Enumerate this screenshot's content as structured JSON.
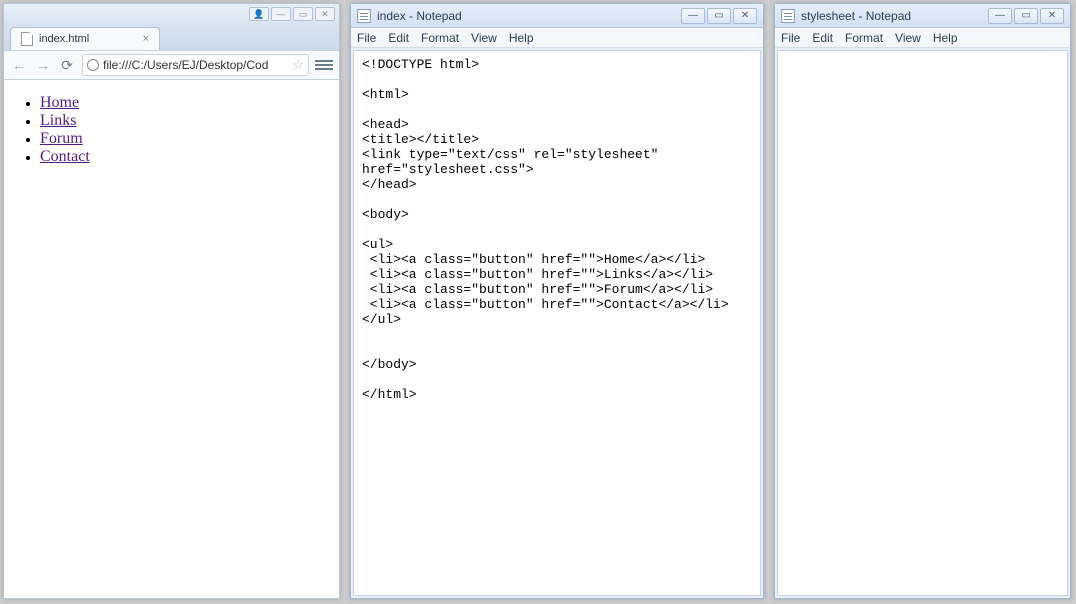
{
  "chrome": {
    "tab_title": "index.html",
    "url": "file:///C:/Users/EJ/Desktop/Cod",
    "links": [
      "Home",
      "Links",
      "Forum",
      "Contact"
    ]
  },
  "notepad1": {
    "title": "index - Notepad",
    "menu": {
      "file": "File",
      "edit": "Edit",
      "format": "Format",
      "view": "View",
      "help": "Help"
    },
    "content": "<!DOCTYPE html>\n\n<html>\n\n<head>\n<title></title>\n<link type=\"text/css\" rel=\"stylesheet\"\nhref=\"stylesheet.css\">\n</head>\n\n<body>\n\n<ul>\n <li><a class=\"button\" href=\"\">Home</a></li>\n <li><a class=\"button\" href=\"\">Links</a></li>\n <li><a class=\"button\" href=\"\">Forum</a></li>\n <li><a class=\"button\" href=\"\">Contact</a></li>\n</ul>\n\n\n</body>\n\n</html>"
  },
  "notepad2": {
    "title": "stylesheet - Notepad",
    "menu": {
      "file": "File",
      "edit": "Edit",
      "format": "Format",
      "view": "View",
      "help": "Help"
    },
    "content": ""
  }
}
